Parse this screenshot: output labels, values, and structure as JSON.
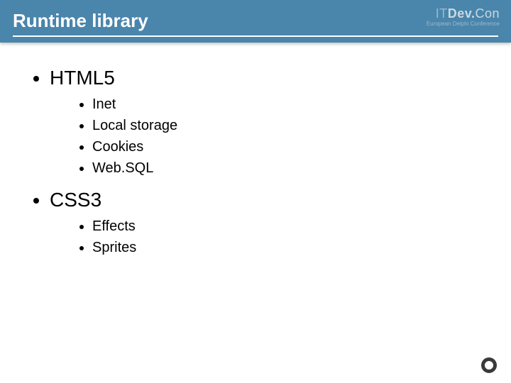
{
  "header": {
    "title": "Runtime library",
    "brand_it": "IT",
    "brand_dev": "Dev.",
    "brand_con": "Con",
    "brand_tagline": "European Delphi Conference"
  },
  "content": {
    "item1": {
      "label": "HTML5",
      "sub": {
        "a": "Inet",
        "b": "Local storage",
        "c": "Cookies",
        "d": "Web.SQL"
      }
    },
    "item2": {
      "label": "CSS3",
      "sub": {
        "a": "Effects",
        "b": "Sprites"
      }
    }
  }
}
